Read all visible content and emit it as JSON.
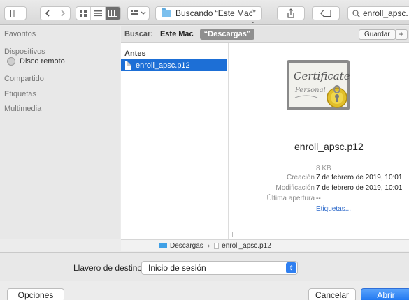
{
  "toolbar": {
    "location_label": "Buscando “Este Mac”",
    "search_value": "enroll_apsc."
  },
  "sidebar": {
    "favorites_label": "Favoritos",
    "devices_label": "Dispositivos",
    "devices": [
      {
        "label": "Disco remoto"
      }
    ],
    "shared_label": "Compartido",
    "tags_label": "Etiquetas",
    "media_label": "Multimedia"
  },
  "scope": {
    "search_label": "Buscar:",
    "this_mac": "Este Mac",
    "downloads": "“Descargas”",
    "save_label": "Guardar",
    "add_label": "+"
  },
  "column": {
    "header": "Antes",
    "files": [
      {
        "name": "enroll_apsc.p12"
      }
    ]
  },
  "preview": {
    "cert_line1": "Certificate",
    "cert_line2": "Personal",
    "file_name": "enroll_apsc.p12",
    "size": "8 KB",
    "created_label": "Creación",
    "created_value": "7 de febrero de 2019, 10:01",
    "modified_label": "Modificación",
    "modified_value": "7 de febrero de 2019, 10:01",
    "opened_label": "Última apertura",
    "opened_value": "--",
    "tags_link": "Etiquetas..."
  },
  "path": {
    "folder": "Descargas",
    "separator": "›",
    "file": "enroll_apsc.p12"
  },
  "keychain": {
    "label": "Llavero de destino:",
    "value": "Inicio de sesión"
  },
  "buttons": {
    "options": "Opciones",
    "cancel": "Cancelar",
    "open": "Abrir"
  },
  "colors": {
    "selection": "#1d6fd6",
    "primary_button": "#1b74f0",
    "link": "#2a67c9"
  }
}
